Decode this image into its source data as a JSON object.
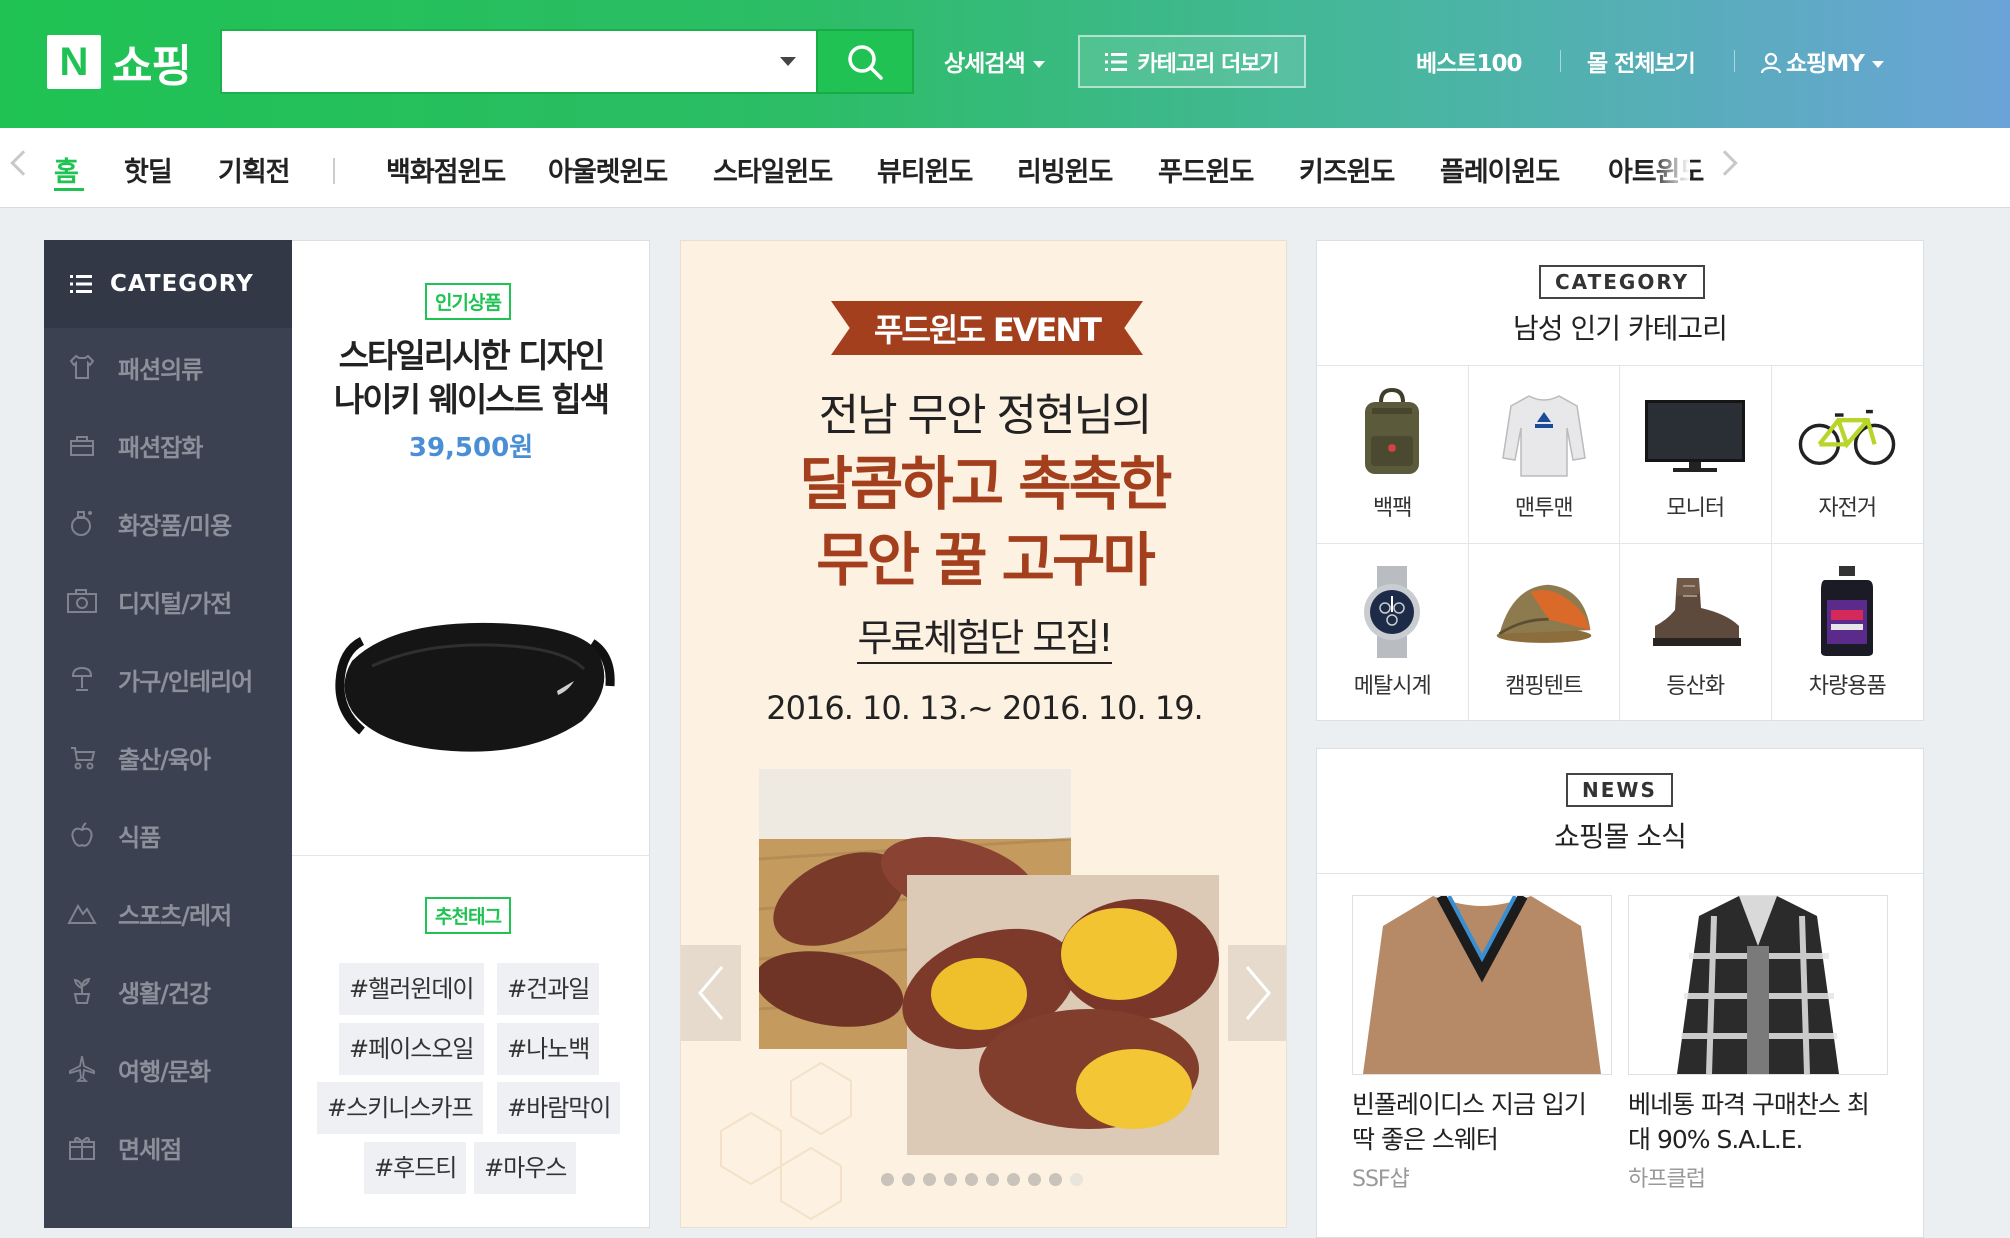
{
  "header": {
    "logo_letter": "N",
    "logo_text": "쇼핑",
    "search_placeholder": "",
    "detail_search": "상세검색",
    "category_more": "카테고리 더보기",
    "best100": "베스트100",
    "all_malls": "몰 전체보기",
    "my_shopping": "쇼핑MY",
    "accent_color": "#1fc253"
  },
  "nav": {
    "items": [
      "홈",
      "핫딜",
      "기획전",
      "백화점윈도",
      "아울렛윈도",
      "스타일윈도",
      "뷰티윈도",
      "리빙윈도",
      "푸드윈도",
      "키즈윈도",
      "플레이윈도",
      "아트윈도"
    ],
    "active": "홈"
  },
  "sidebar": {
    "header": "CATEGORY",
    "items": [
      {
        "label": "패션의류",
        "icon": "shirt-icon"
      },
      {
        "label": "패션잡화",
        "icon": "bag-icon"
      },
      {
        "label": "화장품/미용",
        "icon": "cosmetics-icon"
      },
      {
        "label": "디지털/가전",
        "icon": "camera-icon"
      },
      {
        "label": "가구/인테리어",
        "icon": "lamp-icon"
      },
      {
        "label": "출산/육아",
        "icon": "stroller-icon"
      },
      {
        "label": "식품",
        "icon": "apple-icon"
      },
      {
        "label": "스포츠/레저",
        "icon": "mountain-icon"
      },
      {
        "label": "생활/건강",
        "icon": "plant-icon"
      },
      {
        "label": "여행/문화",
        "icon": "airplane-icon"
      },
      {
        "label": "면세점",
        "icon": "gift-icon"
      }
    ]
  },
  "promo": {
    "badge": "인기상품",
    "title_line1": "스타일리시한 디자인",
    "title_line2": "나이키 웨이스트 힙색",
    "price": "39,500원",
    "tag_badge": "추천태그",
    "tags": [
      "#핼러윈데이",
      "#건과일",
      "#페이스오일",
      "#나노백",
      "#스키니스카프",
      "#바람막이",
      "#후드티",
      "#마우스"
    ]
  },
  "event": {
    "ribbon": "푸드윈도 EVENT",
    "line1": "전남 무안 정현님의",
    "big1": "달콤하고 촉촉한",
    "big2": "무안 꿀 고구마",
    "recruit": "무료체험단 모집!",
    "date": "2016. 10. 13.~ 2016. 10. 19.",
    "dot_count": 10,
    "active_dot": 10
  },
  "category_panel": {
    "badge": "CATEGORY",
    "title": "남성 인기 카테고리",
    "items": [
      {
        "label": "백팩",
        "icon": "backpack-icon"
      },
      {
        "label": "맨투맨",
        "icon": "sweatshirt-icon"
      },
      {
        "label": "모니터",
        "icon": "monitor-icon"
      },
      {
        "label": "자전거",
        "icon": "bicycle-icon"
      },
      {
        "label": "메탈시계",
        "icon": "watch-icon"
      },
      {
        "label": "캠핑텐트",
        "icon": "tent-icon"
      },
      {
        "label": "등산화",
        "icon": "hiking-boot-icon"
      },
      {
        "label": "차량용품",
        "icon": "motor-oil-icon"
      }
    ]
  },
  "news": {
    "badge": "NEWS",
    "title": "쇼핑몰 소식",
    "items": [
      {
        "title": "빈폴레이디스 지금 입기 딱 좋은 스웨터",
        "source": "SSF샵"
      },
      {
        "title": "베네통 파격 구매찬스 최대 90% S.A.L.E.",
        "source": "하프클럽"
      }
    ]
  }
}
